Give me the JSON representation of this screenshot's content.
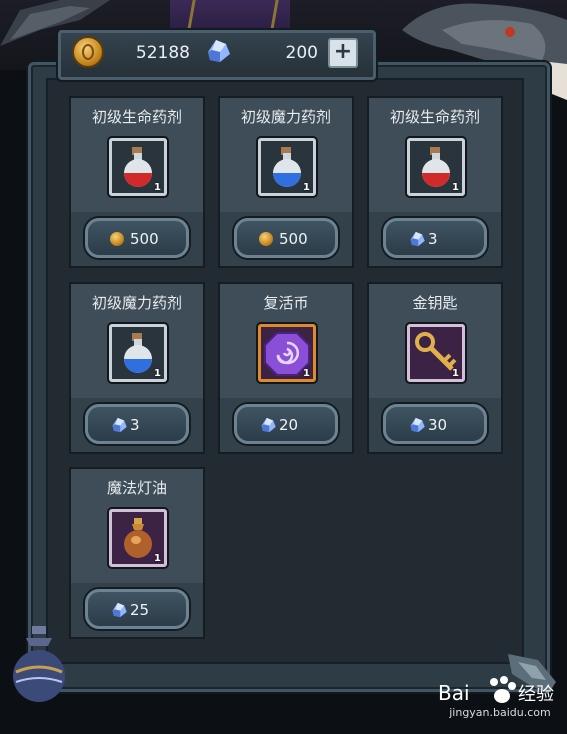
{
  "currency": {
    "gold": "52188",
    "gems": "200"
  },
  "shop_items": [
    {
      "name": "初级生命药剂",
      "icon": "red-potion-icon",
      "qty": "1",
      "price_currency": "gold",
      "price": "500"
    },
    {
      "name": "初级魔力药剂",
      "icon": "blue-potion-icon",
      "qty": "1",
      "price_currency": "gold",
      "price": "500"
    },
    {
      "name": "初级生命药剂",
      "icon": "red-potion-icon",
      "qty": "1",
      "price_currency": "gem",
      "price": "3"
    },
    {
      "name": "初级魔力药剂",
      "icon": "blue-potion-icon",
      "qty": "1",
      "price_currency": "gem",
      "price": "3"
    },
    {
      "name": "复活币",
      "icon": "revive-coin-icon",
      "qty": "1",
      "price_currency": "gem",
      "price": "20"
    },
    {
      "name": "金钥匙",
      "icon": "golden-key-icon",
      "qty": "1",
      "price_currency": "gem",
      "price": "30"
    },
    {
      "name": "魔法灯油",
      "icon": "lamp-oil-icon",
      "qty": "1",
      "price_currency": "gem",
      "price": "25"
    }
  ],
  "watermark": {
    "brand": "Baidu经验",
    "url": "jingyan.baidu.com"
  },
  "colors": {
    "panel": "#2e3c46",
    "frame": "#425563",
    "button": "#3f5463",
    "text": "#e6ecef"
  }
}
